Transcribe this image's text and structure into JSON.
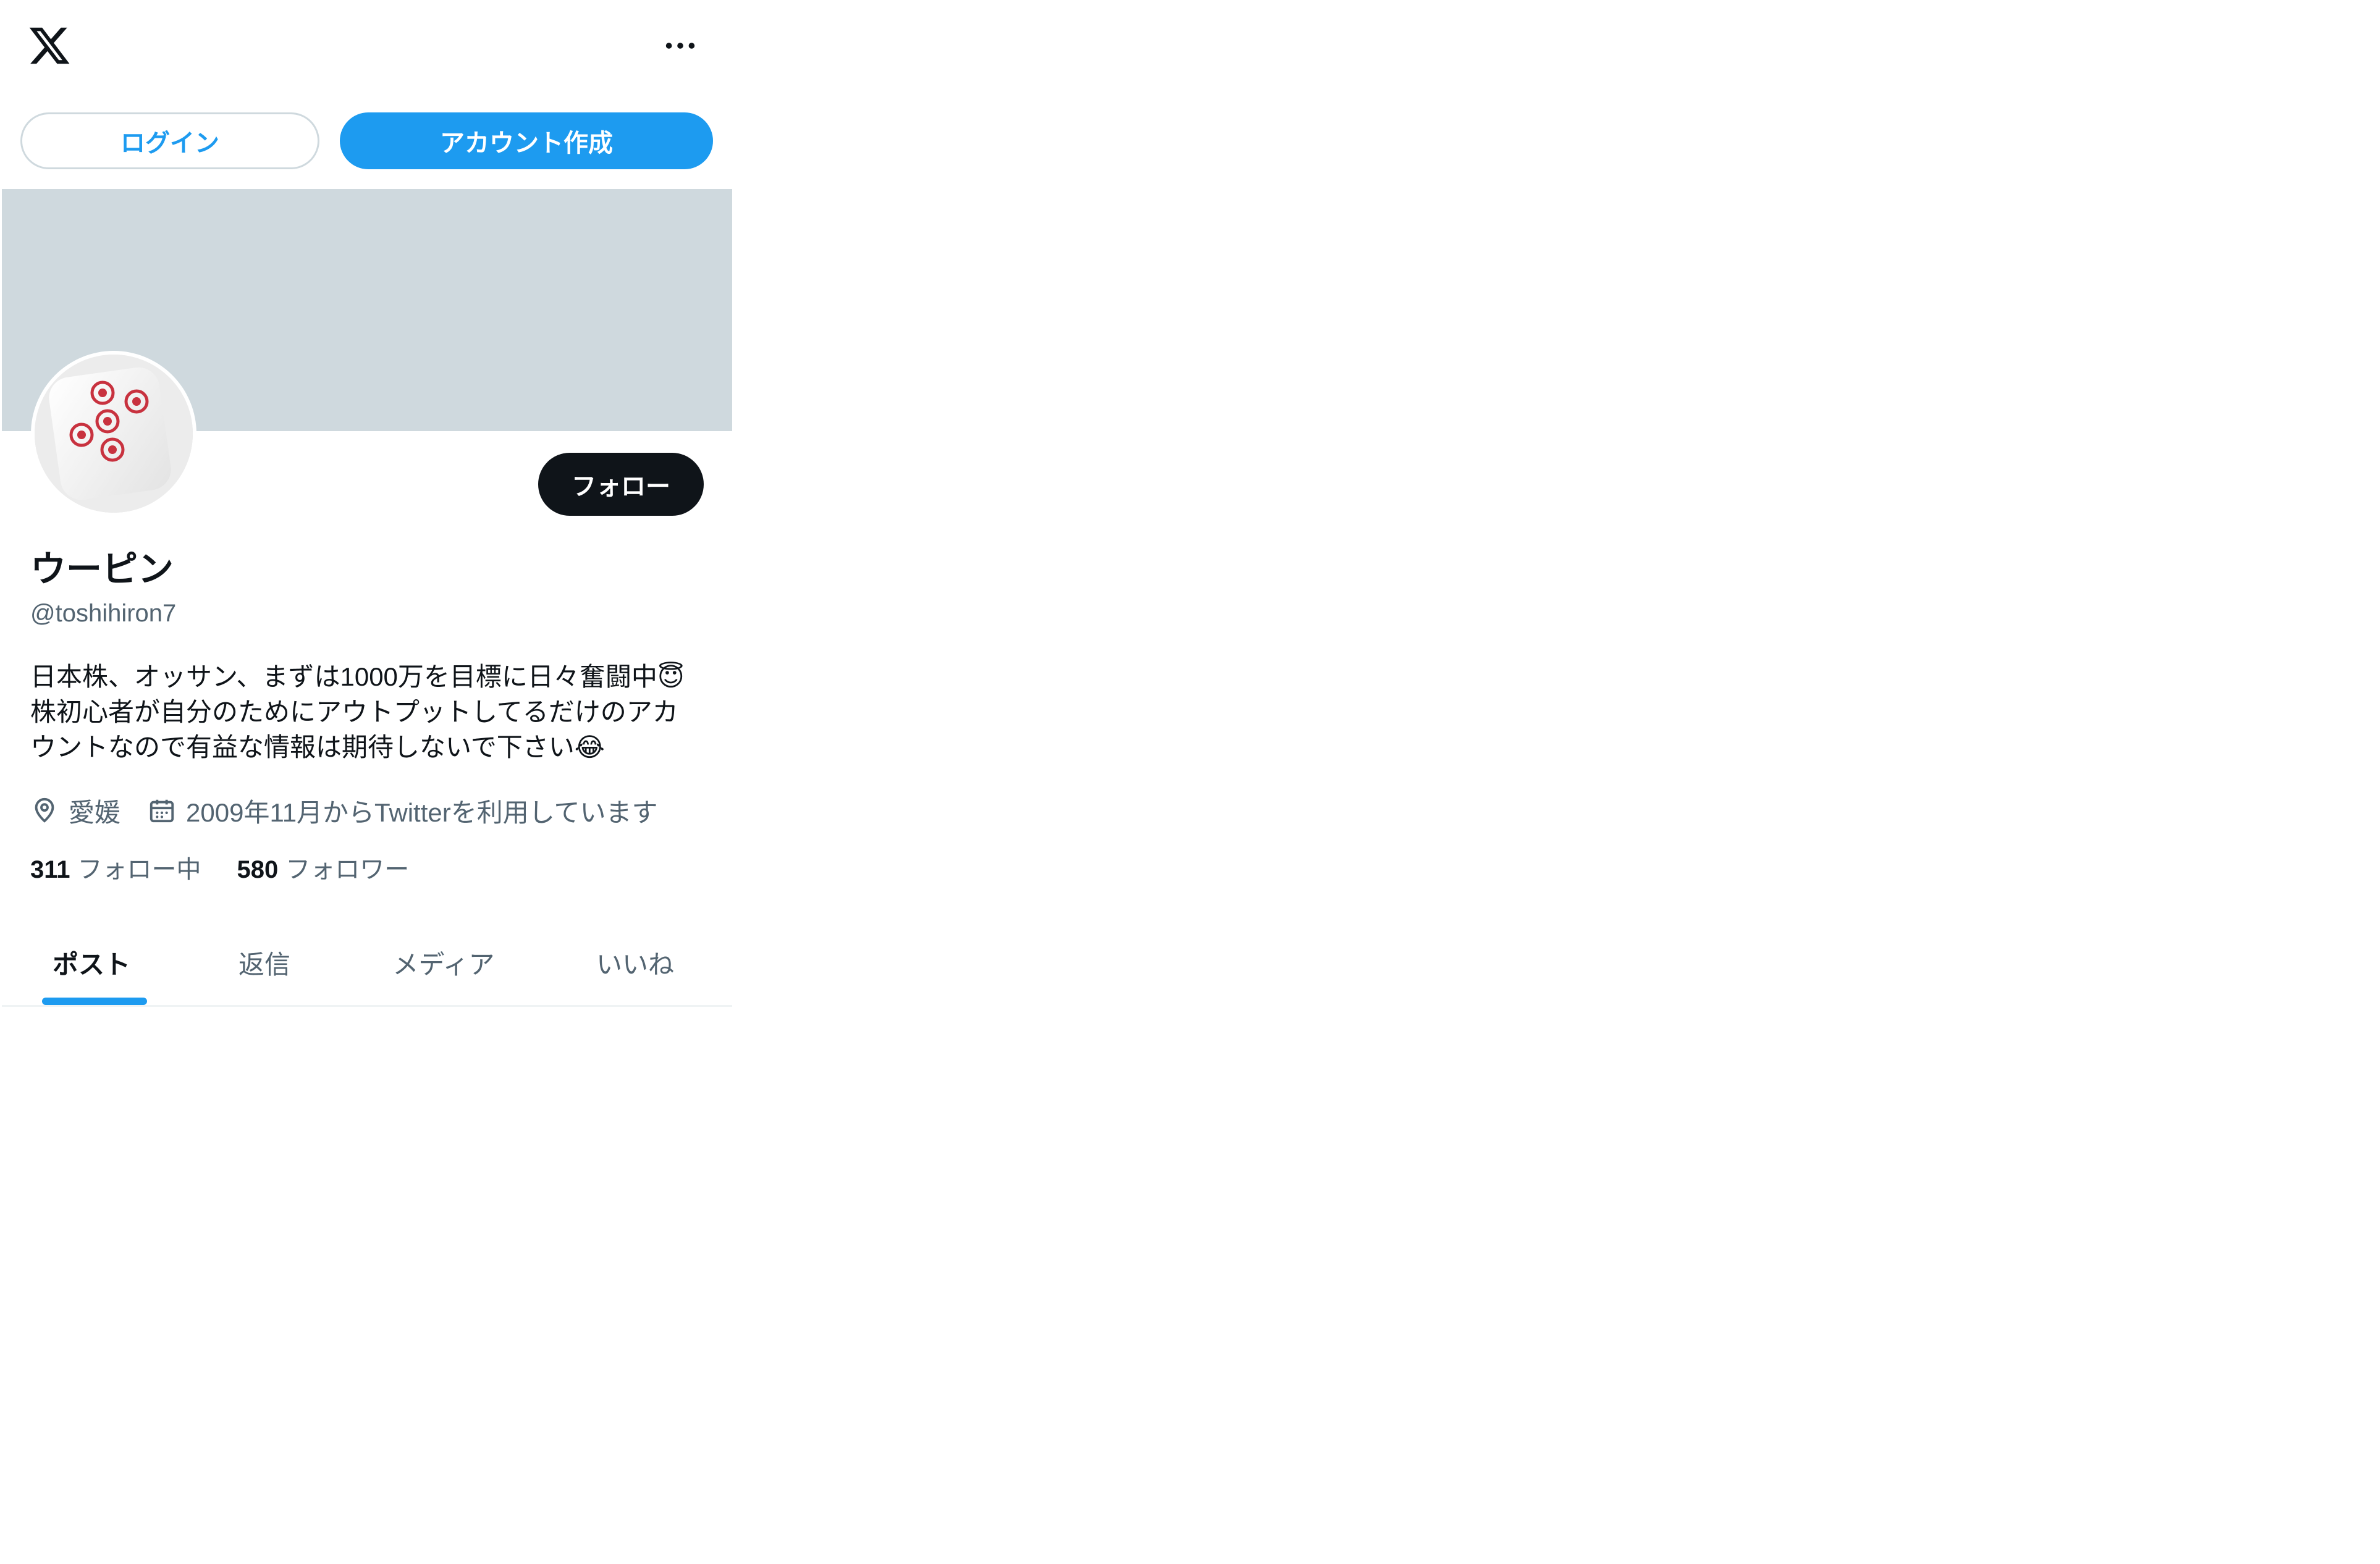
{
  "header": {
    "logo": "x-logo",
    "more_icon": "more-horizontal-icon"
  },
  "auth": {
    "login_label": "ログイン",
    "signup_label": "アカウント作成"
  },
  "profile": {
    "display_name": "ウーピン",
    "handle": "@toshihiron7",
    "follow_label": "フォロー",
    "avatar": "mahjong-five-circles-tile",
    "bio_lines": [
      "日本株、オッサン、まずは1000万を目標に日々奮闘中😇",
      "株初心者が自分のためにアウトプットしてるだけのアカ",
      "ウントなので有益な情報は期待しないで下さい😂"
    ],
    "location": "愛媛",
    "joined": "2009年11月からTwitterを利用しています",
    "following_count": "311",
    "following_label": "フォロー中",
    "followers_count": "580",
    "followers_label": "フォロワー"
  },
  "tabs": [
    {
      "label": "ポスト",
      "active": true
    },
    {
      "label": "返信",
      "active": false
    },
    {
      "label": "メディア",
      "active": false
    },
    {
      "label": "いいね",
      "active": false
    }
  ],
  "colors": {
    "accent": "#1d9bf0",
    "text_primary": "#0f1419",
    "text_secondary": "#536471",
    "banner": "#cfd9de"
  }
}
